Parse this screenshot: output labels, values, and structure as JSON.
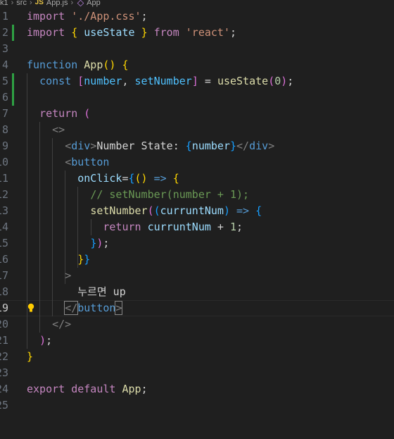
{
  "breadcrumb": {
    "segments": [
      "k1",
      "src",
      "App.js",
      "App"
    ],
    "js_badge": "JS"
  },
  "active_line": 19,
  "lines": [
    {
      "n": "1",
      "t": [
        [
          "kw",
          "import"
        ],
        [
          "txt",
          " "
        ],
        [
          "str",
          "'./App.css'"
        ],
        [
          "txt",
          ";"
        ]
      ]
    },
    {
      "n": "2",
      "t": [
        [
          "kw",
          "import"
        ],
        [
          "txt",
          " "
        ],
        [
          "b1",
          "{"
        ],
        [
          "txt",
          " "
        ],
        [
          "var",
          "useState"
        ],
        [
          "txt",
          " "
        ],
        [
          "b1",
          "}"
        ],
        [
          "txt",
          " "
        ],
        [
          "kw",
          "from"
        ],
        [
          "txt",
          " "
        ],
        [
          "str",
          "'react'"
        ],
        [
          "txt",
          ";"
        ]
      ]
    },
    {
      "n": "3",
      "t": []
    },
    {
      "n": "4",
      "t": [
        [
          "kw2",
          "function"
        ],
        [
          "txt",
          " "
        ],
        [
          "fn",
          "App"
        ],
        [
          "b1",
          "()"
        ],
        [
          "txt",
          " "
        ],
        [
          "b1",
          "{"
        ]
      ]
    },
    {
      "n": "5",
      "t": [
        [
          "txt",
          "  "
        ],
        [
          "kw2",
          "const"
        ],
        [
          "txt",
          " "
        ],
        [
          "b2",
          "["
        ],
        [
          "cst",
          "number"
        ],
        [
          "txt",
          ", "
        ],
        [
          "cst",
          "setNumber"
        ],
        [
          "b2",
          "]"
        ],
        [
          "txt",
          " = "
        ],
        [
          "fn",
          "useState"
        ],
        [
          "b2",
          "("
        ],
        [
          "num",
          "0"
        ],
        [
          "b2",
          ")"
        ],
        [
          "txt",
          ";"
        ]
      ]
    },
    {
      "n": "6",
      "t": []
    },
    {
      "n": "7",
      "t": [
        [
          "txt",
          "  "
        ],
        [
          "kw",
          "return"
        ],
        [
          "txt",
          " "
        ],
        [
          "b2",
          "("
        ]
      ]
    },
    {
      "n": "8",
      "t": [
        [
          "txt",
          "    "
        ],
        [
          "tag",
          "<>"
        ]
      ]
    },
    {
      "n": "9",
      "t": [
        [
          "txt",
          "      "
        ],
        [
          "tag",
          "<"
        ],
        [
          "tagn",
          "div"
        ],
        [
          "tag",
          ">"
        ],
        [
          "txt",
          "Number State: "
        ],
        [
          "b3",
          "{"
        ],
        [
          "var",
          "number"
        ],
        [
          "b3",
          "}"
        ],
        [
          "tag",
          "</"
        ],
        [
          "tagn",
          "div"
        ],
        [
          "tag",
          ">"
        ]
      ]
    },
    {
      "n": "10",
      "t": [
        [
          "txt",
          "      "
        ],
        [
          "tag",
          "<"
        ],
        [
          "tagn",
          "button"
        ]
      ]
    },
    {
      "n": "11",
      "t": [
        [
          "txt",
          "        "
        ],
        [
          "attr",
          "onClick"
        ],
        [
          "txt",
          "="
        ],
        [
          "b3",
          "{"
        ],
        [
          "b1",
          "()"
        ],
        [
          "txt",
          " "
        ],
        [
          "kw2",
          "=>"
        ],
        [
          "txt",
          " "
        ],
        [
          "b1",
          "{"
        ]
      ]
    },
    {
      "n": "12",
      "t": [
        [
          "txt",
          "          "
        ],
        [
          "com",
          "// setNumber(number + 1);"
        ]
      ]
    },
    {
      "n": "13",
      "t": [
        [
          "txt",
          "          "
        ],
        [
          "fn",
          "setNumber"
        ],
        [
          "b2",
          "("
        ],
        [
          "b3",
          "("
        ],
        [
          "var",
          "curruntNum"
        ],
        [
          "b3",
          ")"
        ],
        [
          "txt",
          " "
        ],
        [
          "kw2",
          "=>"
        ],
        [
          "txt",
          " "
        ],
        [
          "b3",
          "{"
        ]
      ]
    },
    {
      "n": "14",
      "t": [
        [
          "txt",
          "            "
        ],
        [
          "kw",
          "return"
        ],
        [
          "txt",
          " "
        ],
        [
          "var",
          "curruntNum"
        ],
        [
          "txt",
          " + "
        ],
        [
          "num",
          "1"
        ],
        [
          "txt",
          ";"
        ]
      ]
    },
    {
      "n": "15",
      "t": [
        [
          "txt",
          "          "
        ],
        [
          "b3",
          "}"
        ],
        [
          "b2",
          ")"
        ],
        [
          "txt",
          ";"
        ]
      ]
    },
    {
      "n": "16",
      "t": [
        [
          "txt",
          "        "
        ],
        [
          "b1",
          "}"
        ],
        [
          "b3",
          "}"
        ]
      ]
    },
    {
      "n": "17",
      "t": [
        [
          "txt",
          "      "
        ],
        [
          "tag",
          ">"
        ]
      ]
    },
    {
      "n": "18",
      "t": [
        [
          "txt",
          "        "
        ],
        [
          "ko",
          "누르면"
        ],
        [
          "txt",
          " up"
        ]
      ]
    },
    {
      "n": "19",
      "t": [
        [
          "txt",
          "      "
        ],
        [
          "tag",
          "</"
        ],
        [
          "tagn",
          "button"
        ],
        [
          "tag",
          ">"
        ]
      ]
    },
    {
      "n": "20",
      "t": [
        [
          "txt",
          "    "
        ],
        [
          "tag",
          "</>"
        ]
      ]
    },
    {
      "n": "21",
      "t": [
        [
          "txt",
          "  "
        ],
        [
          "b2",
          ")"
        ],
        [
          "txt",
          ";"
        ]
      ]
    },
    {
      "n": "22",
      "t": [
        [
          "b1",
          "}"
        ]
      ]
    },
    {
      "n": "23",
      "t": []
    },
    {
      "n": "24",
      "t": [
        [
          "kw",
          "export"
        ],
        [
          "txt",
          " "
        ],
        [
          "kw",
          "default"
        ],
        [
          "txt",
          " "
        ],
        [
          "fn",
          "App"
        ],
        [
          "txt",
          ";"
        ]
      ]
    },
    {
      "n": "25",
      "t": []
    }
  ],
  "colors": {
    "background": "#1f1f1f",
    "git_added": "#2ea043",
    "lightbulb": "#ffcc00"
  }
}
